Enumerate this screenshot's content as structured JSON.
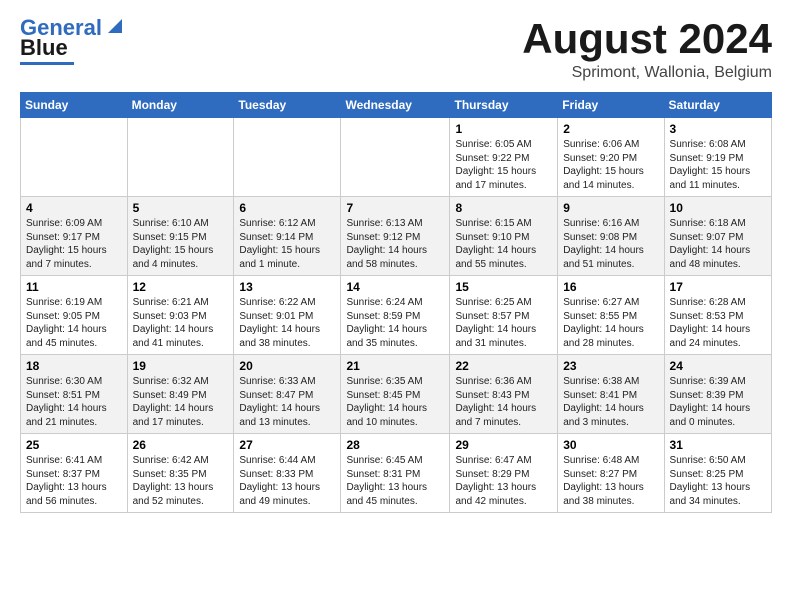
{
  "header": {
    "logo_line1": "General",
    "logo_line2": "Blue",
    "month_year": "August 2024",
    "location": "Sprimont, Wallonia, Belgium"
  },
  "calendar": {
    "days_of_week": [
      "Sunday",
      "Monday",
      "Tuesday",
      "Wednesday",
      "Thursday",
      "Friday",
      "Saturday"
    ],
    "weeks": [
      [
        {
          "day": "",
          "info": ""
        },
        {
          "day": "",
          "info": ""
        },
        {
          "day": "",
          "info": ""
        },
        {
          "day": "",
          "info": ""
        },
        {
          "day": "1",
          "info": "Sunrise: 6:05 AM\nSunset: 9:22 PM\nDaylight: 15 hours\nand 17 minutes."
        },
        {
          "day": "2",
          "info": "Sunrise: 6:06 AM\nSunset: 9:20 PM\nDaylight: 15 hours\nand 14 minutes."
        },
        {
          "day": "3",
          "info": "Sunrise: 6:08 AM\nSunset: 9:19 PM\nDaylight: 15 hours\nand 11 minutes."
        }
      ],
      [
        {
          "day": "4",
          "info": "Sunrise: 6:09 AM\nSunset: 9:17 PM\nDaylight: 15 hours\nand 7 minutes."
        },
        {
          "day": "5",
          "info": "Sunrise: 6:10 AM\nSunset: 9:15 PM\nDaylight: 15 hours\nand 4 minutes."
        },
        {
          "day": "6",
          "info": "Sunrise: 6:12 AM\nSunset: 9:14 PM\nDaylight: 15 hours\nand 1 minute."
        },
        {
          "day": "7",
          "info": "Sunrise: 6:13 AM\nSunset: 9:12 PM\nDaylight: 14 hours\nand 58 minutes."
        },
        {
          "day": "8",
          "info": "Sunrise: 6:15 AM\nSunset: 9:10 PM\nDaylight: 14 hours\nand 55 minutes."
        },
        {
          "day": "9",
          "info": "Sunrise: 6:16 AM\nSunset: 9:08 PM\nDaylight: 14 hours\nand 51 minutes."
        },
        {
          "day": "10",
          "info": "Sunrise: 6:18 AM\nSunset: 9:07 PM\nDaylight: 14 hours\nand 48 minutes."
        }
      ],
      [
        {
          "day": "11",
          "info": "Sunrise: 6:19 AM\nSunset: 9:05 PM\nDaylight: 14 hours\nand 45 minutes."
        },
        {
          "day": "12",
          "info": "Sunrise: 6:21 AM\nSunset: 9:03 PM\nDaylight: 14 hours\nand 41 minutes."
        },
        {
          "day": "13",
          "info": "Sunrise: 6:22 AM\nSunset: 9:01 PM\nDaylight: 14 hours\nand 38 minutes."
        },
        {
          "day": "14",
          "info": "Sunrise: 6:24 AM\nSunset: 8:59 PM\nDaylight: 14 hours\nand 35 minutes."
        },
        {
          "day": "15",
          "info": "Sunrise: 6:25 AM\nSunset: 8:57 PM\nDaylight: 14 hours\nand 31 minutes."
        },
        {
          "day": "16",
          "info": "Sunrise: 6:27 AM\nSunset: 8:55 PM\nDaylight: 14 hours\nand 28 minutes."
        },
        {
          "day": "17",
          "info": "Sunrise: 6:28 AM\nSunset: 8:53 PM\nDaylight: 14 hours\nand 24 minutes."
        }
      ],
      [
        {
          "day": "18",
          "info": "Sunrise: 6:30 AM\nSunset: 8:51 PM\nDaylight: 14 hours\nand 21 minutes."
        },
        {
          "day": "19",
          "info": "Sunrise: 6:32 AM\nSunset: 8:49 PM\nDaylight: 14 hours\nand 17 minutes."
        },
        {
          "day": "20",
          "info": "Sunrise: 6:33 AM\nSunset: 8:47 PM\nDaylight: 14 hours\nand 13 minutes."
        },
        {
          "day": "21",
          "info": "Sunrise: 6:35 AM\nSunset: 8:45 PM\nDaylight: 14 hours\nand 10 minutes."
        },
        {
          "day": "22",
          "info": "Sunrise: 6:36 AM\nSunset: 8:43 PM\nDaylight: 14 hours\nand 7 minutes."
        },
        {
          "day": "23",
          "info": "Sunrise: 6:38 AM\nSunset: 8:41 PM\nDaylight: 14 hours\nand 3 minutes."
        },
        {
          "day": "24",
          "info": "Sunrise: 6:39 AM\nSunset: 8:39 PM\nDaylight: 14 hours\nand 0 minutes."
        }
      ],
      [
        {
          "day": "25",
          "info": "Sunrise: 6:41 AM\nSunset: 8:37 PM\nDaylight: 13 hours\nand 56 minutes."
        },
        {
          "day": "26",
          "info": "Sunrise: 6:42 AM\nSunset: 8:35 PM\nDaylight: 13 hours\nand 52 minutes."
        },
        {
          "day": "27",
          "info": "Sunrise: 6:44 AM\nSunset: 8:33 PM\nDaylight: 13 hours\nand 49 minutes."
        },
        {
          "day": "28",
          "info": "Sunrise: 6:45 AM\nSunset: 8:31 PM\nDaylight: 13 hours\nand 45 minutes."
        },
        {
          "day": "29",
          "info": "Sunrise: 6:47 AM\nSunset: 8:29 PM\nDaylight: 13 hours\nand 42 minutes."
        },
        {
          "day": "30",
          "info": "Sunrise: 6:48 AM\nSunset: 8:27 PM\nDaylight: 13 hours\nand 38 minutes."
        },
        {
          "day": "31",
          "info": "Sunrise: 6:50 AM\nSunset: 8:25 PM\nDaylight: 13 hours\nand 34 minutes."
        }
      ]
    ]
  }
}
